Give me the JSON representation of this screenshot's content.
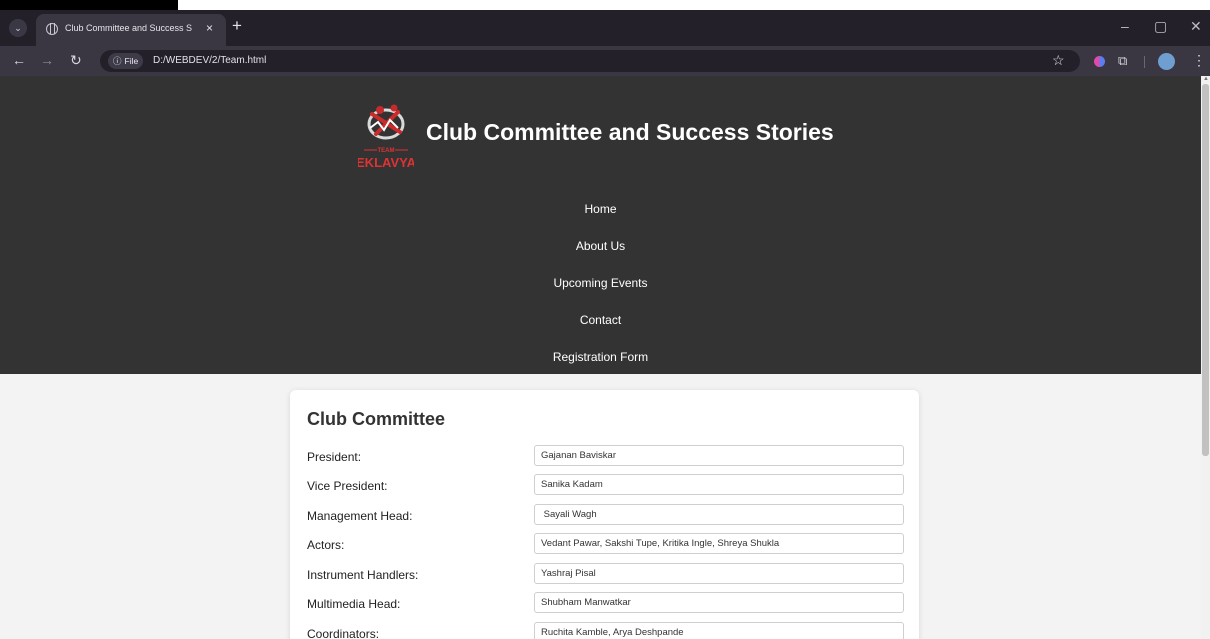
{
  "browser": {
    "tab_title": "Club Committee and Success S",
    "tab_close": "×",
    "new_tab": "+",
    "file_chip": "File",
    "url": "D:/WEBDEV/2/Team.html",
    "icons": [
      "tab-search-icon",
      "globe-icon",
      "back-arrow-icon",
      "forward-arrow-icon",
      "reload-icon",
      "info-icon",
      "bookmark-star-icon",
      "extension-icon",
      "puzzle-icon",
      "profile-avatar-icon",
      "menu-kebab-icon",
      "minimize-icon",
      "restore-icon",
      "close-window-icon"
    ]
  },
  "header": {
    "logo_team": "TEAM",
    "logo_name": "EKLAVYA",
    "title": "Club Committee and Success Stories",
    "bg_color": "#333333"
  },
  "nav": {
    "items": [
      {
        "label": "Home"
      },
      {
        "label": "About Us"
      },
      {
        "label": "Upcoming Events"
      },
      {
        "label": "Contact"
      },
      {
        "label": "Registration Form"
      }
    ]
  },
  "committee": {
    "heading": "Club Committee",
    "rows": [
      {
        "label": "President:",
        "value": "Gajanan Baviskar"
      },
      {
        "label": "Vice President:",
        "value": "Sanika Kadam"
      },
      {
        "label": "Management Head:",
        "value": " Sayali Wagh"
      },
      {
        "label": "Actors:",
        "value": "Vedant Pawar, Sakshi Tupe, Kritika Ingle, Shreya Shukla"
      },
      {
        "label": "Instrument Handlers:",
        "value": "Yashraj Pisal"
      },
      {
        "label": "Multimedia Head:",
        "value": "Shubham Manwatkar"
      },
      {
        "label": "Coordinators:",
        "value": "Ruchita Kamble, Arya Deshpande"
      }
    ]
  }
}
